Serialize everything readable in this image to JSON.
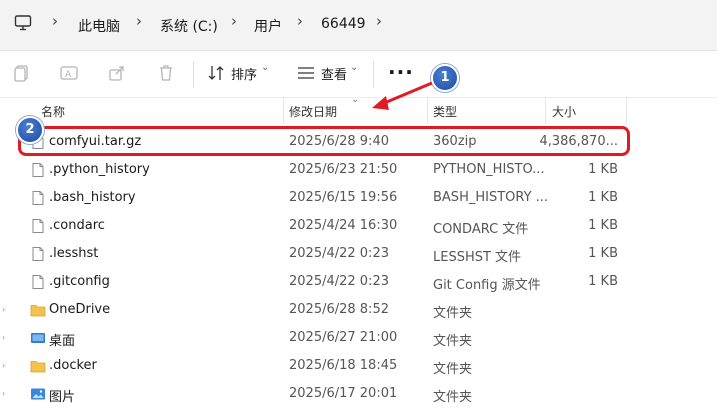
{
  "address_bar": {
    "crumbs": [
      "此电脑",
      "系统 (C:)",
      "用户",
      "66449"
    ]
  },
  "toolbar": {
    "sort_label": "排序",
    "view_label": "查看",
    "more_label": "···"
  },
  "columns": {
    "name": "名称",
    "date": "修改日期",
    "type": "类型",
    "size": "大小"
  },
  "files": [
    {
      "name": "comfyui.tar.gz",
      "date": "2025/6/28 9:40",
      "type": "360zip",
      "size": "4,386,870...",
      "icon": "file-icon",
      "highlighted": true
    },
    {
      "name": ".python_history",
      "date": "2025/6/23 21:50",
      "type": "PYTHON_HISTO...",
      "size": "1 KB",
      "icon": "file-icon"
    },
    {
      "name": ".bash_history",
      "date": "2025/6/15 19:56",
      "type": "BASH_HISTORY ...",
      "size": "1 KB",
      "icon": "file-icon"
    },
    {
      "name": ".condarc",
      "date": "2025/4/24 16:30",
      "type": "CONDARC 文件",
      "size": "1 KB",
      "icon": "file-icon"
    },
    {
      "name": ".lesshst",
      "date": "2025/4/22 0:23",
      "type": "LESSHST 文件",
      "size": "1 KB",
      "icon": "file-icon"
    },
    {
      "name": ".gitconfig",
      "date": "2025/4/22 0:23",
      "type": "Git Config 源文件",
      "size": "1 KB",
      "icon": "file-icon"
    },
    {
      "name": "OneDrive",
      "date": "2025/6/28 8:52",
      "type": "文件夹",
      "size": "",
      "icon": "folder-icon"
    },
    {
      "name": "桌面",
      "date": "2025/6/27 21:00",
      "type": "文件夹",
      "size": "",
      "icon": "desktop-folder-icon"
    },
    {
      "name": ".docker",
      "date": "2025/6/18 18:45",
      "type": "文件夹",
      "size": "",
      "icon": "folder-icon"
    },
    {
      "name": "图片",
      "date": "2025/6/17 20:01",
      "type": "文件夹",
      "size": "",
      "icon": "pictures-folder-icon"
    }
  ],
  "annotations": {
    "badge1": "1",
    "badge2": "2"
  },
  "colors": {
    "highlight": "#e01b24",
    "badge": "#1d4c9c",
    "folder": "#f2c14e"
  }
}
